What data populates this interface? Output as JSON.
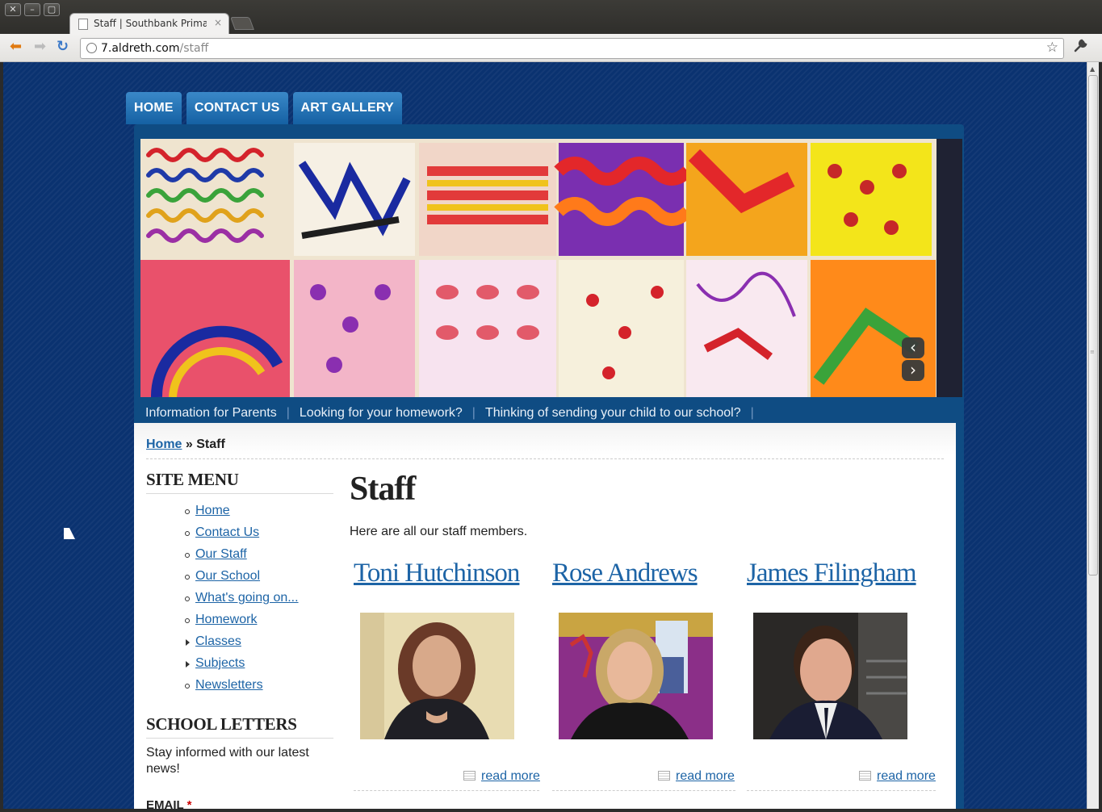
{
  "window": {
    "controls": [
      "✕",
      "–",
      "▢"
    ]
  },
  "browser": {
    "tab_title": "Staff | Southbank Primary",
    "tab_close": "×",
    "url_host": "7.aldreth.com",
    "url_path": "/staff",
    "back": "⬅",
    "forward": "➡",
    "reload": "↻",
    "star": "☆",
    "wrench": "🔧"
  },
  "site": {
    "top_nav": [
      "HOME",
      "CONTACT US",
      "ART GALLERY"
    ],
    "slider": {
      "prev": "‹",
      "next": "›"
    },
    "sub_nav": [
      "Information for Parents",
      "Looking for your homework?",
      "Thinking of sending your child to our school?"
    ],
    "sub_nav_sep": "|",
    "breadcrumb": {
      "home": "Home",
      "sep": " » ",
      "current": "Staff"
    },
    "sidebar": {
      "menu_title": "SITE MENU",
      "menu_items": [
        "Home",
        "Contact Us",
        "Our Staff",
        "Our School",
        "What's going on...",
        "Homework",
        "Classes",
        "Subjects",
        "Newsletters"
      ],
      "letters_title": "SCHOOL LETTERS",
      "letters_text": "Stay informed with our latest news!",
      "email_label": "EMAIL",
      "required_mark": "*"
    },
    "main": {
      "title": "Staff",
      "intro": "Here are all our staff members.",
      "staff": [
        {
          "name": "Toni Hutchinson",
          "read_more": "read more"
        },
        {
          "name": "Rose Andrews",
          "read_more": "read more"
        },
        {
          "name": "James Filingham",
          "read_more": "read more"
        }
      ]
    }
  },
  "colors": {
    "background": "#0a3270",
    "nav_tab": "#1561a3",
    "link": "#1d64a6",
    "frame": "#0f4c83"
  }
}
